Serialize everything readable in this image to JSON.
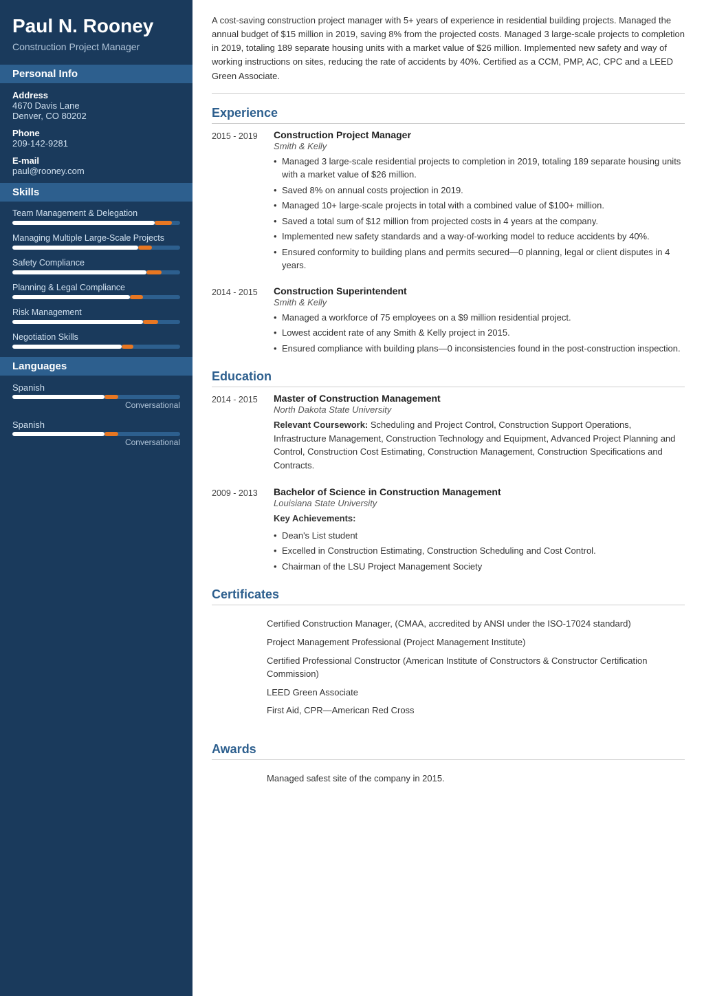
{
  "sidebar": {
    "name": "Paul N. Rooney",
    "title": "Construction Project Manager",
    "personal_info_label": "Personal Info",
    "address_label": "Address",
    "address_value": "4670 Davis Lane\nDenver, CO 80202",
    "phone_label": "Phone",
    "phone_value": "209-142-9281",
    "email_label": "E-mail",
    "email_value": "paul@rooney.com",
    "skills_label": "Skills",
    "skills": [
      {
        "name": "Team Management & Delegation",
        "fill_pct": 85,
        "accent_start": 85,
        "accent_pct": 10
      },
      {
        "name": "Managing Multiple Large-Scale Projects",
        "fill_pct": 75,
        "accent_start": 75,
        "accent_pct": 8
      },
      {
        "name": "Safety Compliance",
        "fill_pct": 80,
        "accent_start": 80,
        "accent_pct": 9
      },
      {
        "name": "Planning & Legal Compliance",
        "fill_pct": 70,
        "accent_start": 70,
        "accent_pct": 8
      },
      {
        "name": "Risk Management",
        "fill_pct": 78,
        "accent_start": 78,
        "accent_pct": 9
      },
      {
        "name": "Negotiation Skills",
        "fill_pct": 65,
        "accent_start": 65,
        "accent_pct": 7
      }
    ],
    "languages_label": "Languages",
    "languages": [
      {
        "name": "Spanish",
        "fill_pct": 55,
        "accent_start": 55,
        "accent_pct": 8,
        "level": "Conversational"
      },
      {
        "name": "Spanish",
        "fill_pct": 55,
        "accent_start": 55,
        "accent_pct": 8,
        "level": "Conversational"
      }
    ]
  },
  "main": {
    "summary": "A cost-saving construction project manager with 5+ years of experience in residential building projects. Managed the annual budget of $15 million in 2019, saving 8% from the projected costs. Managed 3 large-scale projects to completion in 2019, totaling 189 separate housing units with a market value of $26 million. Implemented new safety and way of working instructions on sites, reducing the rate of accidents by 40%. Certified as a CCM, PMP, AC, CPC and a LEED Green Associate.",
    "experience_label": "Experience",
    "experience": [
      {
        "dates": "2015 - 2019",
        "title": "Construction Project Manager",
        "company": "Smith & Kelly",
        "bullets": [
          "Managed 3 large-scale residential projects to completion in 2019, totaling 189 separate housing units with a market value of $26 million.",
          "Saved 8% on annual costs projection in 2019.",
          "Managed 10+ large-scale projects in total with a combined value of $100+ million.",
          "Saved a total sum of $12 million from projected costs in 4 years at the company.",
          "Implemented new safety standards and a way-of-working model to reduce accidents by 40%.",
          "Ensured conformity to building plans and permits secured—0 planning, legal or client disputes in 4 years."
        ]
      },
      {
        "dates": "2014 - 2015",
        "title": "Construction Superintendent",
        "company": "Smith & Kelly",
        "bullets": [
          "Managed a workforce of 75 employees on a $9 million residential project.",
          "Lowest accident rate of any Smith & Kelly project in 2015.",
          "Ensured compliance with building plans—0 inconsistencies found in the post-construction inspection."
        ]
      }
    ],
    "education_label": "Education",
    "education": [
      {
        "dates": "2014 - 2015",
        "degree": "Master of Construction Management",
        "university": "North Dakota State University",
        "coursework_label": "Relevant Coursework:",
        "coursework": "Scheduling and Project Control, Construction Support Operations, Infrastructure Management, Construction Technology and Equipment, Advanced Project Planning and Control, Construction Cost Estimating, Construction Management, Construction Specifications and Contracts.",
        "achievements_label": null,
        "achievements": []
      },
      {
        "dates": "2009 - 2013",
        "degree": "Bachelor of Science in Construction Management",
        "university": "Louisiana State University",
        "coursework_label": null,
        "coursework": null,
        "achievements_label": "Key Achievements:",
        "achievements": [
          "Dean's List student",
          "Excelled in Construction Estimating, Construction Scheduling and Cost Control.",
          "Chairman of the LSU Project Management Society"
        ]
      }
    ],
    "certificates_label": "Certificates",
    "certificates": [
      "Certified Construction Manager, (CMAA, accredited by ANSI under the ISO-17024 standard)",
      "Project Management Professional (Project Management Institute)",
      "Certified Professional Constructor (American Institute of Constructors & Constructor Certification Commission)",
      "LEED Green Associate",
      "First Aid, CPR—American Red Cross"
    ],
    "awards_label": "Awards",
    "awards": [
      "Managed safest site of the company in 2015."
    ]
  }
}
